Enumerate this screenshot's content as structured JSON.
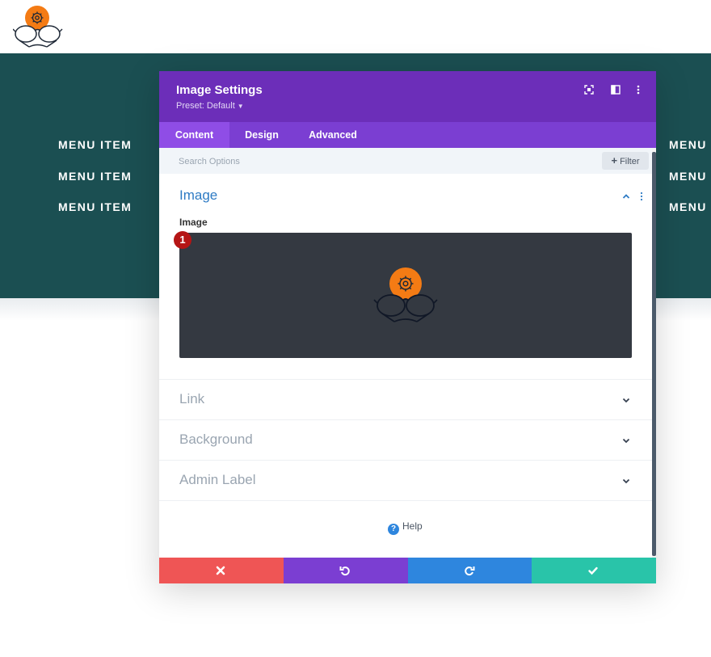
{
  "site": {
    "menu_left": [
      "MENU ITEM",
      "MENU ITEM",
      "MENU ITEM"
    ],
    "menu_right": [
      "MENU I",
      "MENU I",
      "MENU I"
    ]
  },
  "modal": {
    "title": "Image Settings",
    "preset": "Preset: Default",
    "header_icons": [
      "fullscreen-icon",
      "split-view-icon",
      "more-options-icon"
    ],
    "tabs": [
      {
        "label": "Content",
        "active": true
      },
      {
        "label": "Design",
        "active": false
      },
      {
        "label": "Advanced",
        "active": false
      }
    ],
    "search_placeholder": "Search Options",
    "filter_label": "Filter",
    "sections": {
      "image": {
        "title": "Image",
        "field_label": "Image",
        "badge": "1"
      },
      "link": {
        "title": "Link"
      },
      "background": {
        "title": "Background"
      },
      "admin_label": {
        "title": "Admin Label"
      }
    },
    "help_label": "Help",
    "footer_icons": [
      "close-icon",
      "undo-icon",
      "redo-icon",
      "check-icon"
    ]
  },
  "colors": {
    "teal_band": "#1b4f52",
    "header_purple": "#6c2eb9",
    "tab_purple": "#7b3ed2",
    "active_tab": "#8f4de6",
    "section_blue": "#2e7bc4",
    "logo_orange": "#f47b14",
    "cancel_red": "#ef5555",
    "undo_purple": "#7b3ed2",
    "redo_blue": "#2e86de",
    "save_green": "#29c4a9"
  }
}
